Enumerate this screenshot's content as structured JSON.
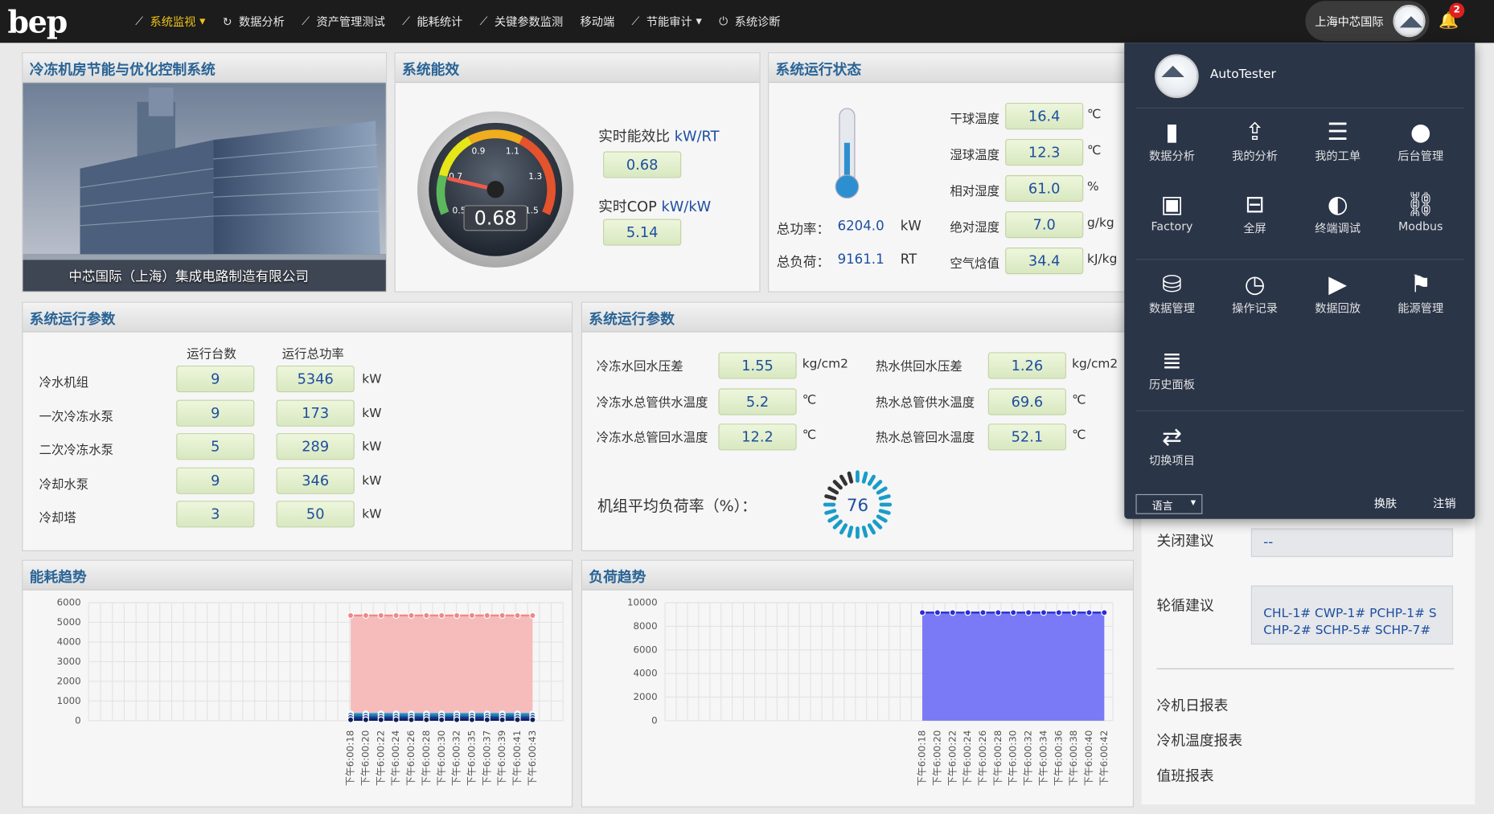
{
  "header": {
    "logo": "bep",
    "nav": [
      {
        "icon": "line-chart-icon",
        "label": "系统监视",
        "active": true,
        "caret": true
      },
      {
        "icon": "refresh-icon",
        "label": "数据分析"
      },
      {
        "icon": "line-chart-icon",
        "label": "资产管理测试"
      },
      {
        "icon": "line-chart-icon",
        "label": "能耗统计"
      },
      {
        "icon": "line-chart-icon",
        "label": "关键参数监测"
      },
      {
        "icon": "",
        "label": "移动端"
      },
      {
        "icon": "line-chart-icon",
        "label": "节能审计",
        "caret": true
      },
      {
        "icon": "power-icon",
        "label": "系统诊断"
      }
    ],
    "project": "上海中芯国际",
    "notification_count": "2"
  },
  "panels": {
    "overview": {
      "title": "冷冻机房节能与优化控制系统",
      "caption": "中芯国际（上海）集成电路制造有限公司"
    },
    "efficiency": {
      "title": "系统能效",
      "gauge_value": "0.68",
      "gauge_ticks": [
        "0.5",
        "0.7",
        "0.9",
        "1.1",
        "1.3",
        "1.5"
      ],
      "eer_label": "实时能效比",
      "eer_unit": "kW/RT",
      "eer_value": "0.68",
      "cop_label": "实时COP",
      "cop_unit": "kW/kW",
      "cop_value": "5.14"
    },
    "status": {
      "title": "系统运行状态",
      "total_power_label": "总功率：",
      "total_power": "6204.0",
      "total_power_unit": "kW",
      "total_load_label": "总负荷：",
      "total_load": "9161.1",
      "total_load_unit": "RT",
      "rows": [
        {
          "label": "干球温度",
          "value": "16.4",
          "unit": "℃"
        },
        {
          "label": "湿球温度",
          "value": "12.3",
          "unit": "℃"
        },
        {
          "label": "相对湿度",
          "value": "61.0",
          "unit": "%"
        },
        {
          "label": "绝对湿度",
          "value": "7.0",
          "unit": "g/kg"
        },
        {
          "label": "空气焓值",
          "value": "34.4",
          "unit": "kJ/kg"
        }
      ]
    },
    "params1": {
      "title": "系统运行参数",
      "col_count": "运行台数",
      "col_power": "运行总功率",
      "rows": [
        {
          "label": "冷水机组",
          "count": "9",
          "power": "5346",
          "unit": "kW"
        },
        {
          "label": "一次冷冻水泵",
          "count": "9",
          "power": "173",
          "unit": "kW"
        },
        {
          "label": "二次冷冻水泵",
          "count": "5",
          "power": "289",
          "unit": "kW"
        },
        {
          "label": "冷却水泵",
          "count": "9",
          "power": "346",
          "unit": "kW"
        },
        {
          "label": "冷却塔",
          "count": "3",
          "power": "50",
          "unit": "kW"
        }
      ]
    },
    "params2": {
      "title": "系统运行参数",
      "left": [
        {
          "label": "冷冻水回水压差",
          "value": "1.55",
          "unit": "kg/cm2"
        },
        {
          "label": "冷冻水总管供水温度",
          "value": "5.2",
          "unit": "℃"
        },
        {
          "label": "冷冻水总管回水温度",
          "value": "12.2",
          "unit": "℃"
        }
      ],
      "right": [
        {
          "label": "热水供回水压差",
          "value": "1.26",
          "unit": "kg/cm2"
        },
        {
          "label": "热水总管供水温度",
          "value": "69.6",
          "unit": "℃"
        },
        {
          "label": "热水总管回水温度",
          "value": "52.1",
          "unit": "℃"
        }
      ],
      "avg_load_label": "机组平均负荷率（%）：",
      "avg_load_value": "76"
    },
    "energy_trend": {
      "title": "能耗趋势"
    },
    "load_trend": {
      "title": "负荷趋势"
    }
  },
  "chart_data": [
    {
      "type": "area",
      "ylim": [
        0,
        6000
      ],
      "yticks": [
        "0",
        "1000",
        "2000",
        "3000",
        "4000",
        "5000",
        "6000"
      ],
      "x": [
        "下午6:00:18",
        "下午6:00:20",
        "下午6:00:22",
        "下午6:00:24",
        "下午6:00:26",
        "下午6:00:28",
        "下午6:00:30",
        "下午6:00:32",
        "下午6:00:35",
        "下午6:00:37",
        "下午6:00:39",
        "下午6:00:41",
        "下午6:00:43"
      ],
      "series": [
        {
          "color": "#f6b8b8",
          "line": "#e88",
          "values": [
            5346,
            5346,
            5346,
            5346,
            5346,
            5346,
            5346,
            5346,
            5346,
            5346,
            5346,
            5346,
            5346
          ]
        },
        {
          "color": "#33a3dc",
          "line": "#33a3dc",
          "values": [
            346,
            346,
            346,
            346,
            346,
            346,
            346,
            346,
            346,
            346,
            346,
            346,
            346
          ]
        },
        {
          "color": "#1f7ab8",
          "line": "#1f7ab8",
          "values": [
            289,
            289,
            289,
            289,
            289,
            289,
            289,
            289,
            289,
            289,
            289,
            289,
            289
          ]
        },
        {
          "color": "#1b3a8a",
          "line": "#1b3a8a",
          "values": [
            173,
            173,
            173,
            173,
            173,
            173,
            173,
            173,
            173,
            173,
            173,
            173,
            173
          ]
        },
        {
          "color": "#0d1f5e",
          "line": "#0d1f5e",
          "values": [
            50,
            50,
            50,
            50,
            50,
            50,
            50,
            50,
            50,
            50,
            50,
            50,
            50
          ]
        }
      ]
    },
    {
      "type": "area",
      "ylim": [
        0,
        10000
      ],
      "yticks": [
        "0",
        "2000",
        "4000",
        "6000",
        "8000",
        "10000"
      ],
      "x": [
        "下午6:00:18",
        "下午6:00:20",
        "下午6:00:22",
        "下午6:00:24",
        "下午6:00:26",
        "下午6:00:28",
        "下午6:00:30",
        "下午6:00:32",
        "下午6:00:34",
        "下午6:00:36",
        "下午6:00:38",
        "下午6:00:40",
        "下午6:00:42"
      ],
      "series": [
        {
          "color": "#7373f5",
          "line": "#2b2bd6",
          "values": [
            9161,
            9161,
            9161,
            9161,
            9161,
            9161,
            9161,
            9161,
            9161,
            9161,
            9161,
            9161,
            9161
          ]
        }
      ]
    }
  ],
  "dropdown": {
    "username": "AutoTester",
    "items": [
      {
        "icon": "bar-chart-icon",
        "glyph": "▮",
        "label": "数据分析"
      },
      {
        "icon": "share-icon",
        "glyph": "⇪",
        "label": "我的分析"
      },
      {
        "icon": "list-icon",
        "glyph": "☰",
        "label": "我的工单"
      },
      {
        "icon": "user-icon",
        "glyph": "●",
        "label": "后台管理"
      },
      {
        "icon": "factory-icon",
        "glyph": "▣",
        "label": "Factory"
      },
      {
        "icon": "fullscreen-icon",
        "glyph": "⊟",
        "label": "全屏"
      },
      {
        "icon": "terminal-icon",
        "glyph": "◐",
        "label": "终端调试"
      },
      {
        "icon": "modbus-icon",
        "glyph": "⛓",
        "label": "Modbus"
      },
      {
        "icon": "database-icon",
        "glyph": "⛁",
        "label": "数据管理"
      },
      {
        "icon": "clock-icon",
        "glyph": "◷",
        "label": "操作记录"
      },
      {
        "icon": "play-icon",
        "glyph": "▶",
        "label": "数据回放"
      },
      {
        "icon": "flag-icon",
        "glyph": "⚑",
        "label": "能源管理"
      },
      {
        "icon": "server-icon",
        "glyph": "≣",
        "label": "历史面板"
      },
      {
        "icon": "switch-icon",
        "glyph": "⇄",
        "label": "切换项目"
      }
    ],
    "language_label": "语言",
    "skin_label": "换肤",
    "logout_label": "注销"
  },
  "side": {
    "close_label": "关闭建议",
    "close_value": "--",
    "rotate_label": "轮循建议",
    "rotate_value": "CHL-1# CWP-1# PCHP-1# SCHP-2# SCHP-5# SCHP-7#",
    "reports": [
      "冷机日报表",
      "冷机温度报表",
      "值班报表"
    ]
  }
}
